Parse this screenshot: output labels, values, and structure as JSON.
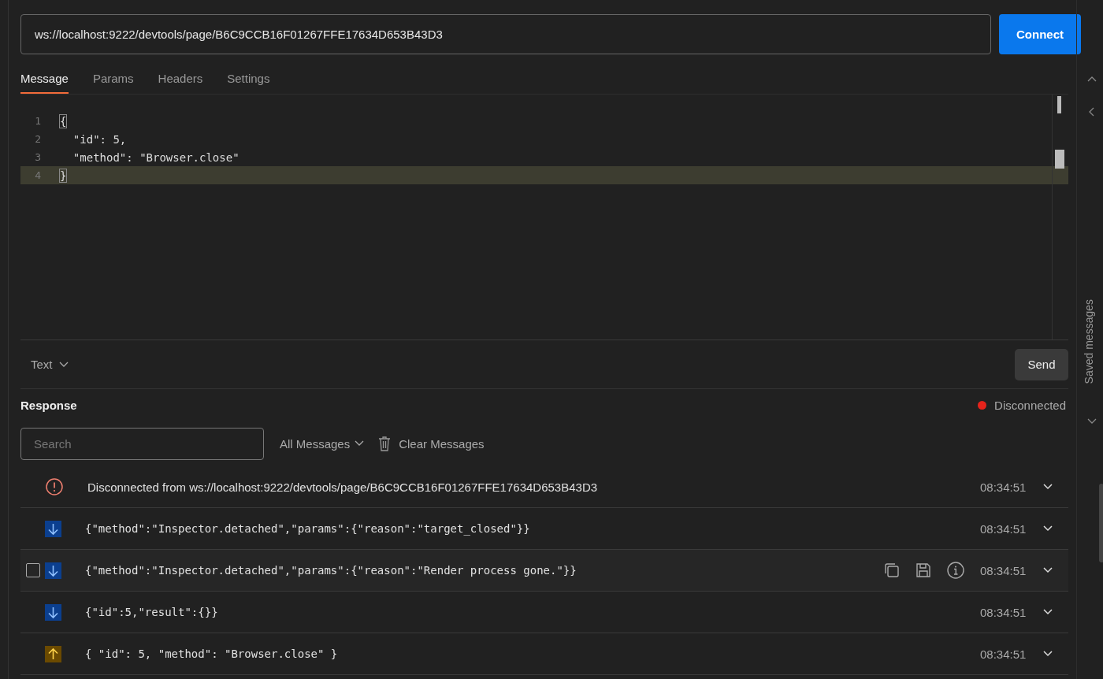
{
  "url_field": {
    "value": "ws://localhost:9222/devtools/page/B6C9CCB16F01267FFE17634D653B43D3"
  },
  "connect_button": "Connect",
  "tabs": [
    {
      "label": "Message",
      "selected": true
    },
    {
      "label": "Params",
      "selected": false
    },
    {
      "label": "Headers",
      "selected": false
    },
    {
      "label": "Settings",
      "selected": false
    }
  ],
  "editor": {
    "lines": [
      {
        "number": "1",
        "text": "{",
        "bracket_match": true,
        "active": false
      },
      {
        "number": "2",
        "text": "  \"id\": 5,",
        "bracket_match": false,
        "active": false
      },
      {
        "number": "3",
        "text": "  \"method\": \"Browser.close\"",
        "bracket_match": false,
        "active": false
      },
      {
        "number": "4",
        "text": "}",
        "bracket_match": true,
        "active": true
      }
    ]
  },
  "format_dropdown": "Text",
  "send_button": "Send",
  "saved_messages_label": "Saved messages",
  "response": {
    "title": "Response",
    "status": {
      "label": "Disconnected",
      "color": "#e5231b"
    },
    "search": {
      "placeholder": "Search"
    },
    "filter_dropdown": "All Messages",
    "clear_button": "Clear Messages",
    "messages": [
      {
        "kind": "error",
        "text": "Disconnected from ws://localhost:9222/devtools/page/B6C9CCB16F01267FFE17634D653B43D3",
        "time": "08:34:51",
        "hovered": false
      },
      {
        "kind": "incoming",
        "text": "{\"method\":\"Inspector.detached\",\"params\":{\"reason\":\"target_closed\"}}",
        "time": "08:34:51",
        "hovered": false
      },
      {
        "kind": "incoming",
        "text": "{\"method\":\"Inspector.detached\",\"params\":{\"reason\":\"Render process gone.\"}}",
        "time": "08:34:51",
        "hovered": true,
        "checked": false
      },
      {
        "kind": "incoming",
        "text": "{\"id\":5,\"result\":{}}",
        "time": "08:34:51",
        "hovered": false
      },
      {
        "kind": "outgoing",
        "text": "{ \"id\": 5, \"method\": \"Browser.close\" }",
        "time": "08:34:51",
        "hovered": false
      }
    ]
  }
}
